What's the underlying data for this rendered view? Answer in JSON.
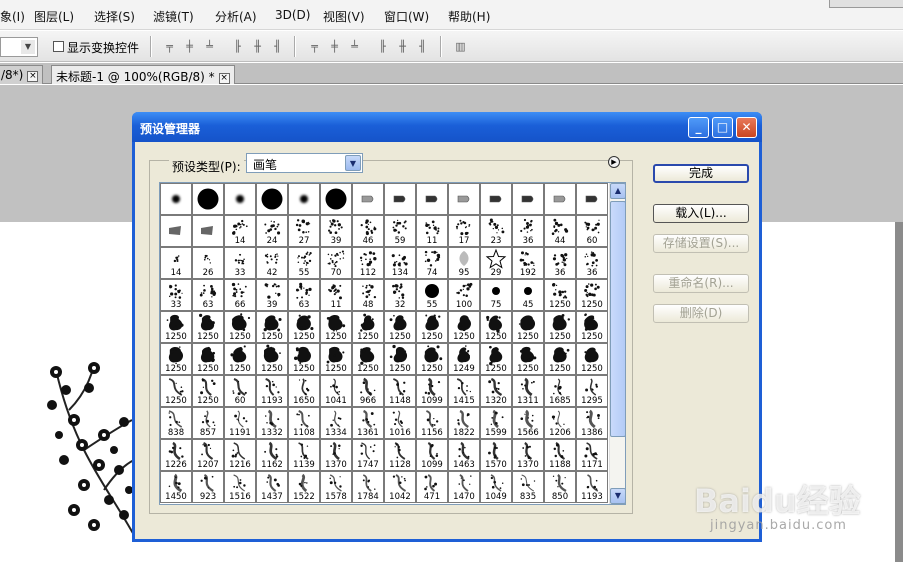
{
  "menubar": {
    "items": [
      "象(I)",
      "图层(L)",
      "选择(S)",
      "滤镜(T)",
      "分析(A)",
      "3D(D)",
      "视图(V)",
      "窗口(W)",
      "帮助(H)"
    ]
  },
  "options_bar": {
    "show_transform_label": "显示变换控件",
    "show_transform_checked": false
  },
  "tabs": [
    {
      "label": "/8*)",
      "active": false
    },
    {
      "label": "未标题-1 @ 100%(RGB/8) *",
      "active": true
    }
  ],
  "dialog": {
    "title": "预设管理器",
    "preset_type_label": "预设类型(P):",
    "preset_type_value": "画笔",
    "buttons": {
      "done": "完成",
      "load": "载入(L)...",
      "save_set": "存储设置(S)...",
      "rename": "重命名(R)...",
      "delete": "删除(D)"
    },
    "brush_sizes": [
      [
        "",
        "",
        "",
        "",
        "",
        "",
        "",
        "",
        "",
        "",
        "",
        "",
        "",
        ""
      ],
      [
        "",
        "",
        "14",
        "24",
        "27",
        "39",
        "46",
        "59",
        "11",
        "17",
        "23",
        "36",
        "44",
        "60"
      ],
      [
        "14",
        "26",
        "33",
        "42",
        "55",
        "70",
        "112",
        "134",
        "74",
        "95",
        "29",
        "192",
        "36",
        "36"
      ],
      [
        "33",
        "63",
        "66",
        "39",
        "63",
        "11",
        "48",
        "32",
        "55",
        "100",
        "75",
        "45",
        "1250",
        "1250"
      ],
      [
        "1250",
        "1250",
        "1250",
        "1250",
        "1250",
        "1250",
        "1250",
        "1250",
        "1250",
        "1250",
        "1250",
        "1250",
        "1250",
        "1250"
      ],
      [
        "1250",
        "1250",
        "1250",
        "1250",
        "1250",
        "1250",
        "1250",
        "1250",
        "1250",
        "1249",
        "1250",
        "1250",
        "1250",
        "1250"
      ],
      [
        "1250",
        "1250",
        "60",
        "1193",
        "1650",
        "1041",
        "966",
        "1148",
        "1099",
        "1415",
        "1320",
        "1311",
        "1685",
        "1295"
      ],
      [
        "838",
        "857",
        "1191",
        "1332",
        "1108",
        "1334",
        "1361",
        "1016",
        "1156",
        "1822",
        "1599",
        "1566",
        "1206",
        "1386"
      ],
      [
        "1226",
        "1207",
        "1216",
        "1162",
        "1139",
        "1370",
        "1747",
        "1128",
        "1099",
        "1463",
        "1570",
        "1370",
        "1188",
        "1171"
      ],
      [
        "1450",
        "923",
        "1516",
        "1437",
        "1522",
        "1578",
        "1784",
        "1042",
        "471",
        "1470",
        "1049",
        "835",
        "850",
        "1193"
      ]
    ]
  },
  "watermark": {
    "brand": "Baidu经验",
    "url": "jingyan.baidu.com"
  },
  "colors": {
    "dialog_bg": "#ece9d8",
    "title_blue": "#1a5fd8",
    "workspace_gray": "#c1c1c1"
  }
}
